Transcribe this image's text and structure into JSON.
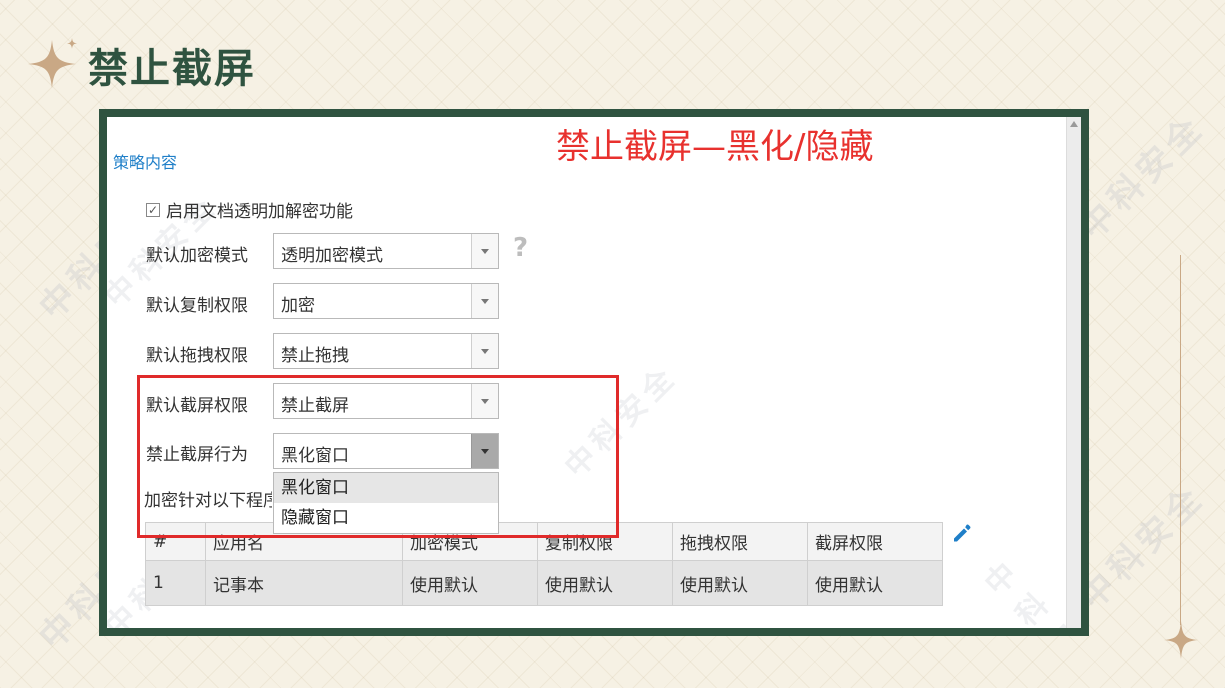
{
  "slide": {
    "title": "禁止截屏"
  },
  "watermark": {
    "text": "中科安全"
  },
  "screen": {
    "annotation": "禁止截屏—黑化/隐藏",
    "section_title": "策略内容",
    "checkbox": {
      "checked": true,
      "mark": "✓",
      "label": "启用文档透明加解密功能"
    },
    "form": [
      {
        "label": "默认加密模式",
        "value": "透明加密模式"
      },
      {
        "label": "默认复制权限",
        "value": "加密"
      },
      {
        "label": "默认拖拽权限",
        "value": "禁止拖拽"
      },
      {
        "label": "默认截屏权限",
        "value": "禁止截屏"
      },
      {
        "label": "禁止截屏行为",
        "value": "黑化窗口"
      }
    ],
    "help_icon": "question-icon",
    "dropdown": {
      "options": [
        "黑化窗口",
        "隐藏窗口"
      ],
      "highlighted_index": 0
    },
    "partial_label": "加密针对以下程序",
    "table": {
      "headers": [
        "#",
        "应用名",
        "加密模式",
        "复制权限",
        "拖拽权限",
        "截屏权限"
      ],
      "rows": [
        [
          "1",
          "记事本",
          "使用默认",
          "使用默认",
          "使用默认",
          "使用默认"
        ]
      ]
    },
    "edit_icon": "pencil-icon"
  },
  "colors": {
    "frame": "#2f5340",
    "title": "#2f5340",
    "annotation": "#e8312e",
    "highlight_box": "#e02a2a",
    "section_title": "#1f7fc8",
    "accent_star": "#c9a885"
  }
}
